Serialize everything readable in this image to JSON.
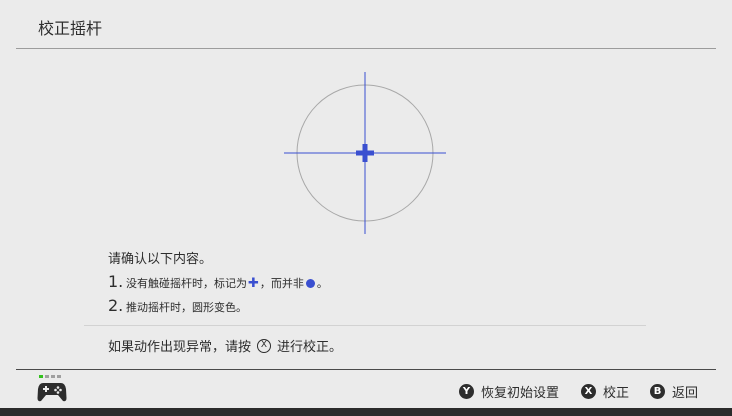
{
  "header": {
    "title": "校正摇杆"
  },
  "instructions": {
    "confirm": "请确认以下内容。",
    "items": [
      {
        "number": "1.",
        "before": "没有触碰摇杆时，标记为",
        "mid": "，而并非",
        "after": "。"
      },
      {
        "number": "2.",
        "text": "推动摇杆时，圆形变色。"
      }
    ],
    "abnormal_before": "如果动作出现异常，请按",
    "abnormal_button_glyph": "X",
    "abnormal_after": "进行校正。"
  },
  "footer": {
    "reset": {
      "glyph": "Y",
      "label": "恢复初始设置"
    },
    "calibrate": {
      "glyph": "X",
      "label": "校正"
    },
    "back": {
      "glyph": "B",
      "label": "返回"
    }
  },
  "icons": {
    "stick": "stick-calibration-crosshair-icon",
    "controller": "gamepad-icon",
    "plus": "blue-plus-marker-icon",
    "dot": "blue-dot-marker-icon"
  },
  "colors": {
    "accent_blue": "#3a4fd0",
    "player_led_green": "#33c21e",
    "background": "#ebebeb",
    "text": "#2d2d2d"
  }
}
